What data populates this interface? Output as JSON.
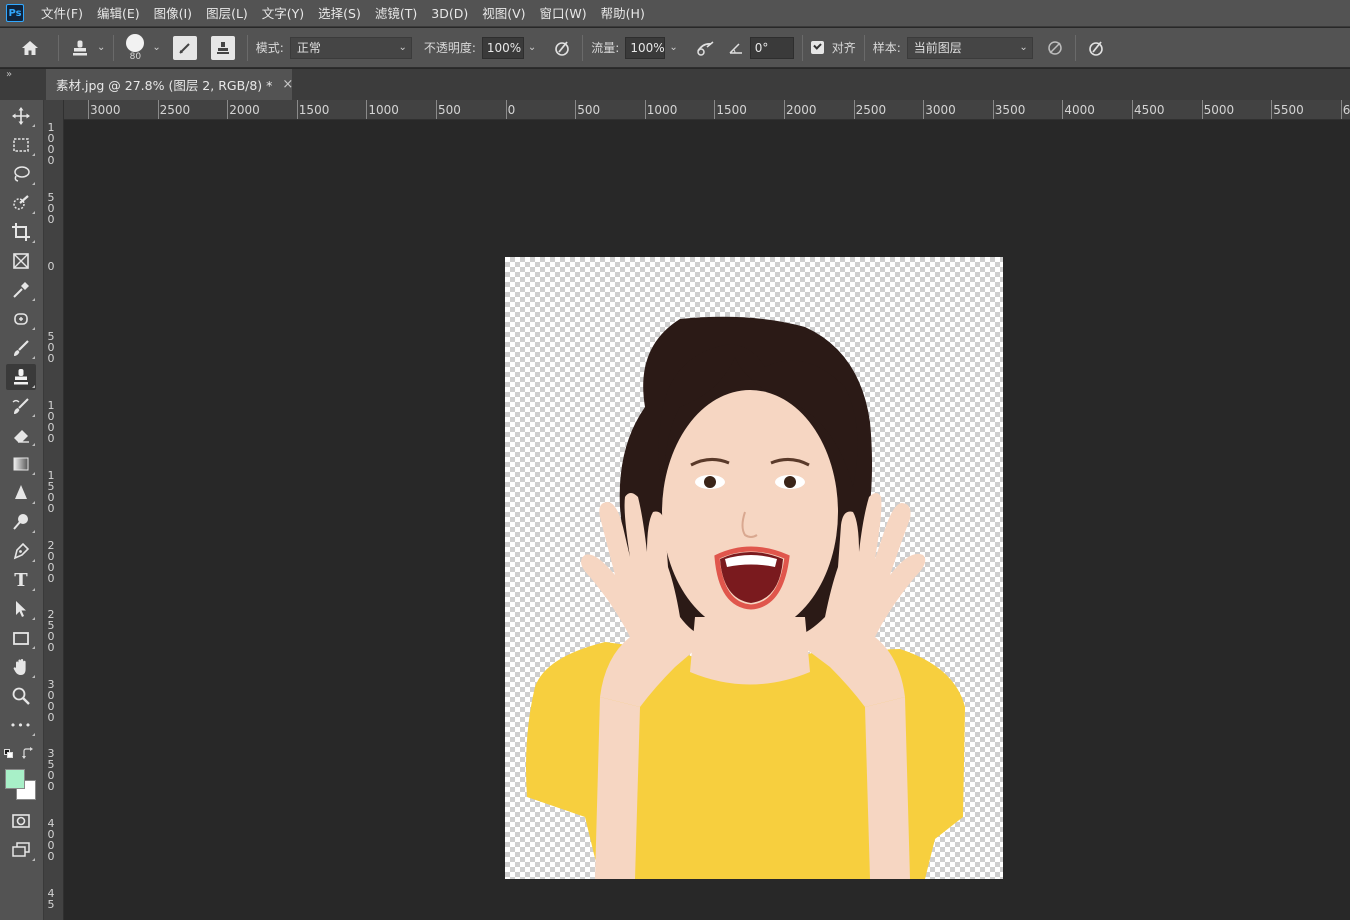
{
  "app": {
    "logo_text": "Ps"
  },
  "menu": [
    "文件(F)",
    "编辑(E)",
    "图像(I)",
    "图层(L)",
    "文字(Y)",
    "选择(S)",
    "滤镜(T)",
    "3D(D)",
    "视图(V)",
    "窗口(W)",
    "帮助(H)"
  ],
  "options": {
    "brush_size": "80",
    "mode_label": "模式:",
    "mode_value": "正常",
    "opacity_label": "不透明度:",
    "opacity_value": "100%",
    "flow_label": "流量:",
    "flow_value": "100%",
    "angle_value": "0°",
    "align_label": "对齐",
    "align_checked": true,
    "sample_label": "样本:",
    "sample_value": "当前图层"
  },
  "document_tab": {
    "title": "素材.jpg @ 27.8% (图层 2, RGB/8) *",
    "close": "×"
  },
  "collapse_glyph": "»",
  "ruler_top": [
    "3000",
    "2500",
    "2000",
    "1500",
    "1000",
    "500",
    "0",
    "500",
    "1000",
    "1500",
    "2000",
    "2500",
    "3000",
    "3500",
    "4000",
    "4500",
    "5000",
    "5500",
    "6"
  ],
  "ruler_left": [
    "1000",
    "500",
    "0",
    "500",
    "1000",
    "1500",
    "2000",
    "2500",
    "3000",
    "3500",
    "4000",
    "45"
  ],
  "colors": {
    "foreground": "#a8f0c8",
    "background": "#ffffff",
    "ui_panel": "#535353",
    "workspace": "#282828",
    "shirt": "#f7cf3e",
    "skin": "#f6d6c2",
    "hair": "#2b1a16"
  },
  "tools": [
    "move-icon",
    "marquee-icon",
    "lasso-icon",
    "quick-select-icon",
    "crop-icon",
    "frame-icon",
    "eyedropper-icon",
    "healing-icon",
    "brush-icon",
    "clone-stamp-icon",
    "history-brush-icon",
    "eraser-icon",
    "gradient-icon",
    "blur-icon",
    "dodge-icon",
    "pen-icon",
    "type-icon",
    "path-select-icon",
    "rectangle-icon",
    "hand-icon",
    "zoom-icon",
    "more-icon"
  ],
  "type_tool_glyph": "T",
  "more_tool_glyph": "•••"
}
